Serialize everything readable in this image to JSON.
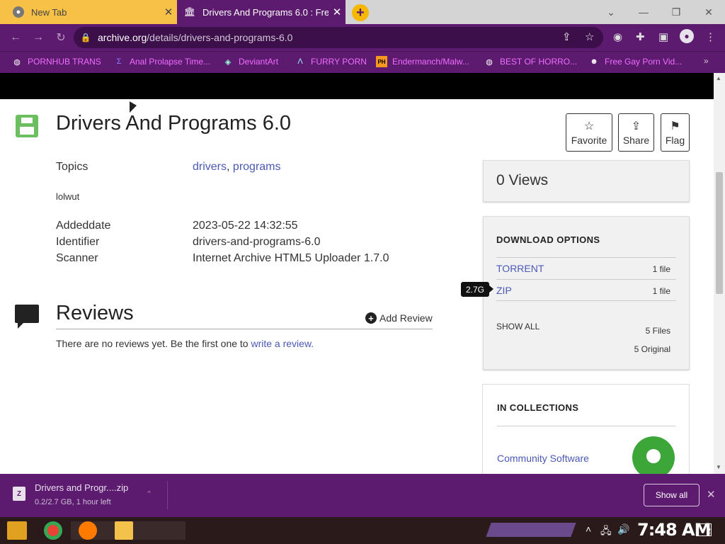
{
  "browser": {
    "tabs": [
      {
        "title": "New Tab",
        "active": false
      },
      {
        "title": "Drivers And Programs 6.0 : Fre",
        "active": true
      }
    ],
    "url_domain": "archive.org",
    "url_path": "/details/drivers-and-programs-6.0",
    "bookmarks": [
      {
        "label": "PORNHUB TRANS",
        "icon": "globe-icon"
      },
      {
        "label": "Anal Prolapse Time...",
        "icon": "sigma-icon"
      },
      {
        "label": "DeviantArt",
        "icon": "deviantart-icon"
      },
      {
        "label": "FURRY PORN",
        "icon": "lambda-icon"
      },
      {
        "label": "Endermanch/Malw...",
        "icon": "ph-icon"
      },
      {
        "label": "BEST OF HORRO...",
        "icon": "globe-icon"
      },
      {
        "label": "Free Gay Porn Vid...",
        "icon": "mascot-icon"
      }
    ],
    "bookmark_ph": "PH"
  },
  "item": {
    "title": "Drivers And Programs 6.0",
    "topics_label": "Topics",
    "topics": [
      "drivers",
      "programs"
    ],
    "topic_sep": ",",
    "description": "lolwut",
    "meta": [
      {
        "label": "Addeddate",
        "value": "2023-05-22 14:32:55"
      },
      {
        "label": "Identifier",
        "value": "drivers-and-programs-6.0"
      },
      {
        "label": "Scanner",
        "value": "Internet Archive HTML5 Uploader 1.7.0"
      }
    ],
    "actions": {
      "favorite": "Favorite",
      "share": "Share",
      "flag": "Flag"
    }
  },
  "views": "0 Views",
  "download": {
    "heading": "DOWNLOAD OPTIONS",
    "rows": [
      {
        "name": "TORRENT",
        "count": "1 file"
      },
      {
        "name": "ZIP",
        "count": "1 file"
      }
    ],
    "tooltip": "2.7G",
    "show_all": "SHOW ALL",
    "files": "5 Files",
    "original": "5 Original"
  },
  "collections": {
    "heading": "IN COLLECTIONS",
    "item": "Community Software"
  },
  "reviews": {
    "title": "Reviews",
    "add": "Add Review",
    "empty_text": "There are no reviews yet. Be the first one to ",
    "empty_link": "write a review."
  },
  "download_bar": {
    "filename": "Drivers and Progr....zip",
    "status": "0.2/2.7 GB, 1 hour left",
    "show_all": "Show all"
  },
  "taskbar": {
    "clock": "7:48 AM",
    "notifications": "2"
  }
}
